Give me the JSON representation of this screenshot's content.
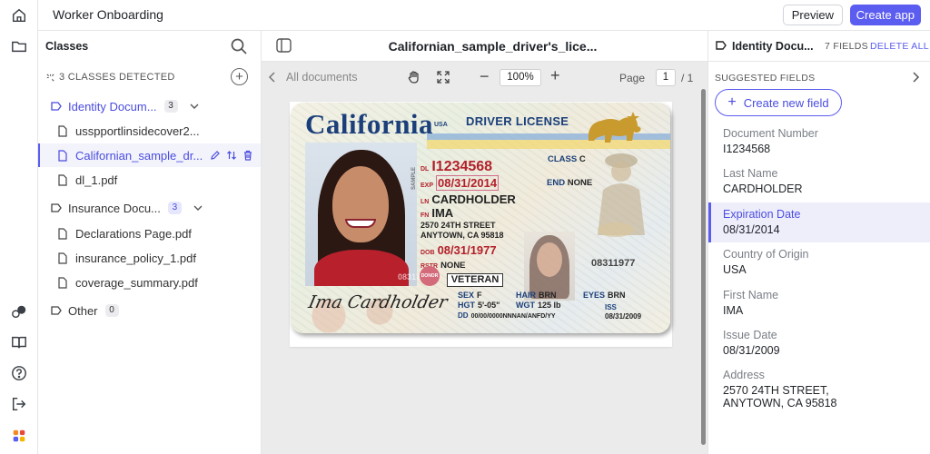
{
  "app": {
    "title": "Worker Onboarding",
    "preview_label": "Preview",
    "create_app_label": "Create app"
  },
  "rail": {
    "icons": [
      "home-icon",
      "folder-icon",
      "community-icon",
      "book-icon",
      "help-icon",
      "logout-icon",
      "apps-icon"
    ]
  },
  "classes": {
    "title": "Classes",
    "detected_label": "3 CLASSES DETECTED",
    "groups": [
      {
        "name": "Identity Docum...",
        "count": "3",
        "files": [
          "usspportlinsidecover2...",
          "Californian_sample_dr...",
          "dl_1.pdf"
        ]
      },
      {
        "name": "Insurance Docu...",
        "count": "3",
        "files": [
          "Declarations Page.pdf",
          "insurance_policy_1.pdf",
          "coverage_summary.pdf"
        ]
      },
      {
        "name": "Other",
        "count": "0",
        "files": []
      }
    ]
  },
  "viewer": {
    "doc_title": "Californian_sample_driver's_lice...",
    "back_label": "All documents",
    "zoom": "100%",
    "page_label": "Page",
    "page_current": "1",
    "page_total": "/ 1"
  },
  "license": {
    "state": "California",
    "country": "USA",
    "title": "DRIVER LICENSE",
    "dl_label": "DL",
    "dl_number": "I1234568",
    "exp_label": "EXP",
    "exp": "08/31/2014",
    "class_label": "CLASS",
    "class_value": "C",
    "end_label": "END",
    "end_value": "NONE",
    "ln_label": "LN",
    "last_name": "CARDHOLDER",
    "fn_label": "FN",
    "first_name": "IMA",
    "address1": "2570 24TH STREET",
    "address2": "ANYTOWN, CA 95818",
    "dob_label": "DOB",
    "dob": "08/31/1977",
    "rstr_label": "RSTR",
    "rstr": "NONE",
    "small_number": "08311977",
    "donor": "DONOR",
    "veteran": "VETERAN",
    "sex_label": "SEX",
    "sex": "F",
    "hair_label": "HAIR",
    "hair": "BRN",
    "eyes_label": "EYES",
    "eyes": "BRN",
    "hgt_label": "HGT",
    "hgt": "5'-05\"",
    "wgt_label": "WGT",
    "wgt": "125 lb",
    "dd_label": "DD",
    "dd": "00/00/0000NNNAN/ANFD/YY",
    "iss_label": "ISS",
    "iss": "08/31/2009",
    "signature": "Ima Cardholder",
    "photo_number": "083177",
    "sample": "SAMPLE"
  },
  "fields_panel": {
    "class_name": "Identity Docu...",
    "fields_count": "7 FIELDS",
    "delete_all": "DELETE ALL",
    "suggested_label": "SUGGESTED FIELDS",
    "create_field_label": "Create new field",
    "fields": [
      {
        "label": "Document Number",
        "value": "I1234568"
      },
      {
        "label": "Last Name",
        "value": "CARDHOLDER"
      },
      {
        "label": "Expiration Date",
        "value": "08/31/2014"
      },
      {
        "label": "Country of Origin",
        "value": "USA"
      },
      {
        "label": "First Name",
        "value": "IMA"
      },
      {
        "label": "Issue Date",
        "value": "08/31/2009"
      },
      {
        "label": "Address",
        "value": "2570 24TH STREET,",
        "value2": "ANYTOWN, CA 95818"
      }
    ]
  },
  "colors": {
    "accent": "#5b5cf0",
    "card_title": "#1b3f7a",
    "card_red": "#b3202a"
  }
}
